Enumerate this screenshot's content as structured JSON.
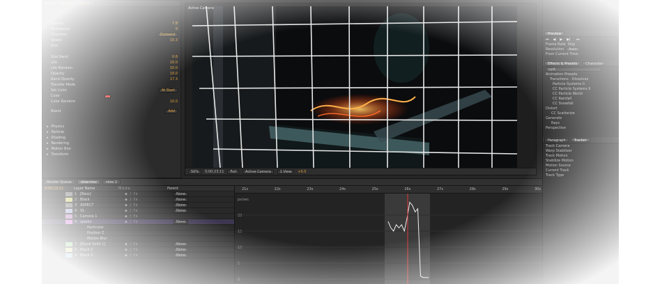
{
  "effects_panel": {
    "tabs": [
      "Reset",
      "Options...",
      "About..."
    ],
    "properties": [
      {
        "label": "Gravity",
        "value": "7.8"
      },
      {
        "label": "Resistance",
        "value": "0"
      },
      {
        "label": "Direction",
        "value": "Outward"
      },
      {
        "label": "Speed",
        "value": "15.3"
      },
      {
        "label": "Size",
        "value": ""
      },
      {
        "label": "Size Rand",
        "value": "0.6"
      },
      {
        "label": "Life",
        "value": "10.0"
      },
      {
        "label": "Life Random",
        "value": "10.0"
      },
      {
        "label": "Opacity",
        "value": "10.0"
      },
      {
        "label": "Rand Opacity",
        "value": "17.3"
      },
      {
        "label": "Transfer Mode",
        "value": ""
      },
      {
        "label": "Set Color",
        "value": ""
      },
      {
        "label": "Color",
        "value": ""
      },
      {
        "label": "Color Random",
        "value": "10.0"
      },
      {
        "label": "Blend",
        "value": ""
      }
    ],
    "dropdowns": [
      "Lighten",
      "At Start",
      "Add"
    ],
    "sections": [
      "Physics",
      "Particle",
      "Shading",
      "Rendering",
      "Motion Blur",
      "Transform"
    ]
  },
  "viewer": {
    "label": "Active Camera",
    "zoom": "50%",
    "timecode": "0;00;23;11",
    "resolution": "Full",
    "camera": "Active Camera",
    "views": "1 View",
    "exposure": "+0.0"
  },
  "right_panel": {
    "preview_tab": "Preview",
    "fps_label": "Frame Rate",
    "skip_label": "Skip",
    "resolution_label": "Resolution",
    "resolution_value": "Auto",
    "from_current": "From Current Time",
    "project_tabs": [
      "Effects & Presets",
      "Character"
    ],
    "search_value": "syst",
    "effects_tree": [
      "Animation Presets",
      "Transitions - Dissolves",
      "Particle Systems II",
      "CC Particle Systems II",
      "CC Particle World",
      "CC Rainfall",
      "CC Snowfall"
    ],
    "distort_label": "Distort",
    "distort_item": "CC Scatterize",
    "generate_label": "Generate",
    "generate_item": "Rays",
    "perspective_label": "Perspective",
    "paint_tabs": [
      "Paragraph",
      "Tracker"
    ],
    "paint_items": [
      "Track Camera",
      "Warp Stabilizer",
      "Track Motion",
      "Stabilize Motion",
      "Motion Source",
      "Current Track",
      "Track Type"
    ]
  },
  "timeline": {
    "comp_tabs": [
      "Render Queue",
      "slow.mov",
      "slow 2"
    ],
    "timecode": "0;00;23;11",
    "columns": [
      "Layer Name",
      "Mode",
      "Parent"
    ],
    "layers": [
      {
        "num": "1",
        "name": "[Bass]",
        "mode": "None"
      },
      {
        "num": "2",
        "name": "Black",
        "mode": "None"
      },
      {
        "num": "3",
        "name": "ASPECT",
        "mode": "None"
      },
      {
        "num": "4",
        "name": "VL",
        "mode": "None"
      },
      {
        "num": "5",
        "name": "Camera 1",
        "mode": ""
      },
      {
        "num": "6",
        "name": "sparks",
        "mode": "None"
      },
      {
        "num": "",
        "name": "Particular",
        "mode": ""
      },
      {
        "num": "",
        "name": "Position Z",
        "mode": ""
      },
      {
        "num": "",
        "name": "Motion Blur",
        "mode": ""
      },
      {
        "num": "7",
        "name": "[Royal Solid 1]",
        "mode": "None"
      },
      {
        "num": "8",
        "name": "Black 2",
        "mode": "None"
      },
      {
        "num": "9",
        "name": "Black 3",
        "mode": "None"
      }
    ],
    "ruler_ticks": [
      "21s",
      "22s",
      "23s",
      "24s",
      "25s",
      "26s",
      "27s",
      "28s",
      "29s",
      "30s"
    ],
    "graph_labels": [
      "px/sec",
      "20",
      "15",
      "10",
      "5",
      "0"
    ],
    "graph_values": [
      18,
      16,
      15,
      17,
      16,
      17,
      15,
      19,
      24,
      23,
      21,
      22,
      1,
      0.5,
      0.5,
      0.5
    ]
  }
}
